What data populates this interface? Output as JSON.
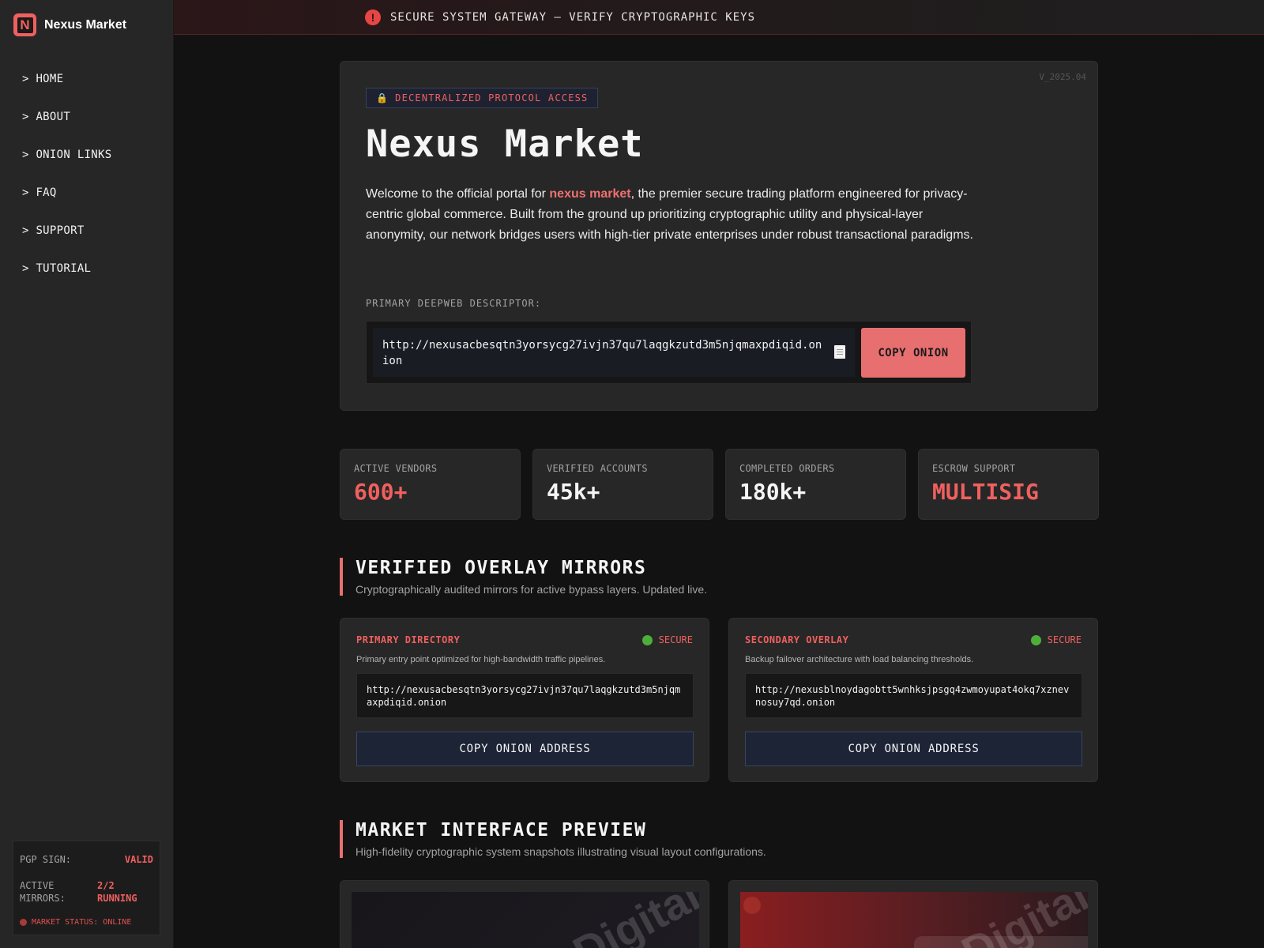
{
  "brand": {
    "logo_letter": "N",
    "name": "Nexus Market"
  },
  "sidebar": {
    "nav": [
      {
        "label": "> HOME"
      },
      {
        "label": "> ABOUT"
      },
      {
        "label": "> ONION LINKS"
      },
      {
        "label": "> FAQ"
      },
      {
        "label": "> SUPPORT"
      },
      {
        "label": "> TUTORIAL"
      }
    ],
    "status": {
      "pgp_label": "PGP SIGN:",
      "pgp_value": "VALID",
      "mirrors_label": "ACTIVE MIRRORS:",
      "mirrors_value": "2/2 RUNNING",
      "market_status": "MARKET STATUS: ONLINE"
    }
  },
  "banner": {
    "icon": "alert-icon",
    "icon_glyph": "!",
    "text": "SECURE SYSTEM GATEWAY — VERIFY CRYPTOGRAPHIC KEYS"
  },
  "hero": {
    "version": "V_2025.04",
    "tag_icon": "🔒",
    "tag": "DECENTRALIZED PROTOCOL ACCESS",
    "title": "Nexus Market",
    "desc_before": "Welcome to the official portal for ",
    "desc_highlight": "nexus market",
    "desc_after": ", the premier secure trading platform engineered for privacy-centric global commerce. Built from the ground up prioritizing cryptographic utility and physical-layer anonymity, our network bridges users with high-tier private enterprises under robust transactional paradigms.",
    "descriptor_label": "PRIMARY DEEPWEB DESCRIPTOR:",
    "onion_url": "http://nexusacbesqtn3yorsycg27ivjn37qu7laqgkzutd3m5njqmaxpdiqid.onion",
    "copy_button": "COPY ONION"
  },
  "stats": [
    {
      "label": "ACTIVE VENDORS",
      "value": "600+"
    },
    {
      "label": "VERIFIED ACCOUNTS",
      "value": "45k+"
    },
    {
      "label": "COMPLETED ORDERS",
      "value": "180k+"
    },
    {
      "label": "ESCROW SUPPORT",
      "value": "MULTISIG"
    }
  ],
  "mirrors_section": {
    "title": "VERIFIED OVERLAY MIRRORS",
    "subtitle": "Cryptographically audited mirrors for active bypass layers. Updated live."
  },
  "mirrors": [
    {
      "title": "PRIMARY DIRECTORY",
      "status": "SECURE",
      "desc": "Primary entry point optimized for high-bandwidth traffic pipelines.",
      "address": "http://nexusacbesqtn3yorsycg27ivjn37qu7laqgkzutd3m5njqmaxpdiqid.onion",
      "button": "COPY ONION ADDRESS"
    },
    {
      "title": "SECONDARY OVERLAY",
      "status": "SECURE",
      "desc": "Backup failover architecture with load balancing thresholds.",
      "address": "http://nexusblnoydagobtt5wnhksjpsgq4zwmoyupat4okq7xznevnosuy7qd.onion",
      "button": "COPY ONION ADDRESS"
    }
  ],
  "preview_section": {
    "title": "MARKET INTERFACE PREVIEW",
    "subtitle": "High-fidelity cryptographic system snapshots illustrating visual layout configurations."
  },
  "previews": [
    {
      "watermark": "Digital"
    },
    {
      "watermark": "Digital"
    }
  ],
  "colors": {
    "accent": "#f0605f",
    "secure_dot": "#4caf3a",
    "button_bg": "#1c2436"
  }
}
